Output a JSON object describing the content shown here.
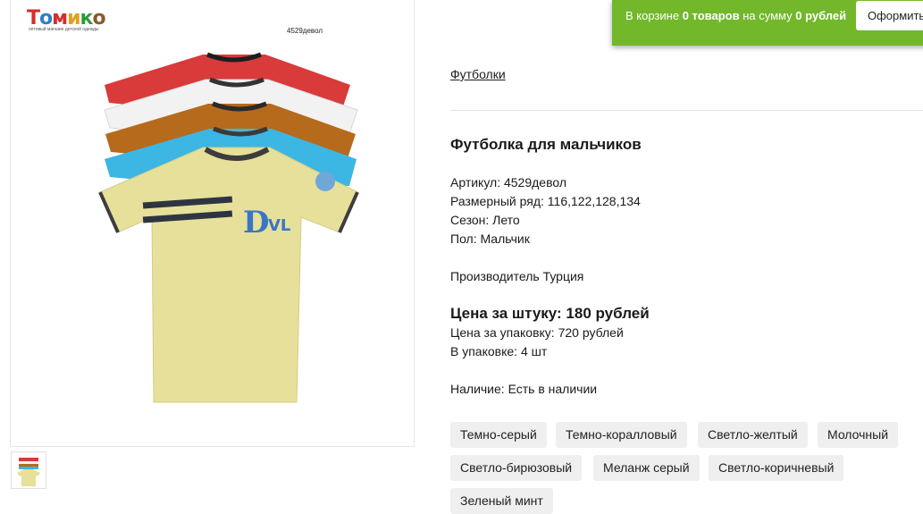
{
  "logo": {
    "name": "Томико",
    "subtitle": "оптовый магазин детской одежды"
  },
  "image": {
    "code": "4529девол",
    "print": "DVL"
  },
  "cart": {
    "prefix": "В корзине",
    "count": "0 товаров",
    "mid": "на сумму",
    "sum": "0 рублей",
    "checkout": "Оформить"
  },
  "breadcrumb": "Футболки",
  "product": {
    "title": "Футболка для мальчиков",
    "article": "Артикул: 4529девол",
    "sizes": "Размерный ряд: 116,122,128,134",
    "season": "Сезон: Лето",
    "gender": "Пол: Мальчик",
    "maker": "Производитель Турция",
    "price_unit": "Цена за штуку: 180 рублей",
    "price_pack": "Цена за упаковку: 720 рублей",
    "pack_qty": "В упаковке: 4 шт",
    "stock": "Наличие: Есть в наличии"
  },
  "colors": [
    "Темно-серый",
    "Темно-коралловый",
    "Светло-желтый",
    "Молочный",
    "Светло-бирюзовый",
    "Меланж серый",
    "Светло-коричневый",
    "Зеленый мint"
  ],
  "brand_colors": {
    "cart_bg": "#72b82a",
    "chip_bg": "#efefef"
  }
}
